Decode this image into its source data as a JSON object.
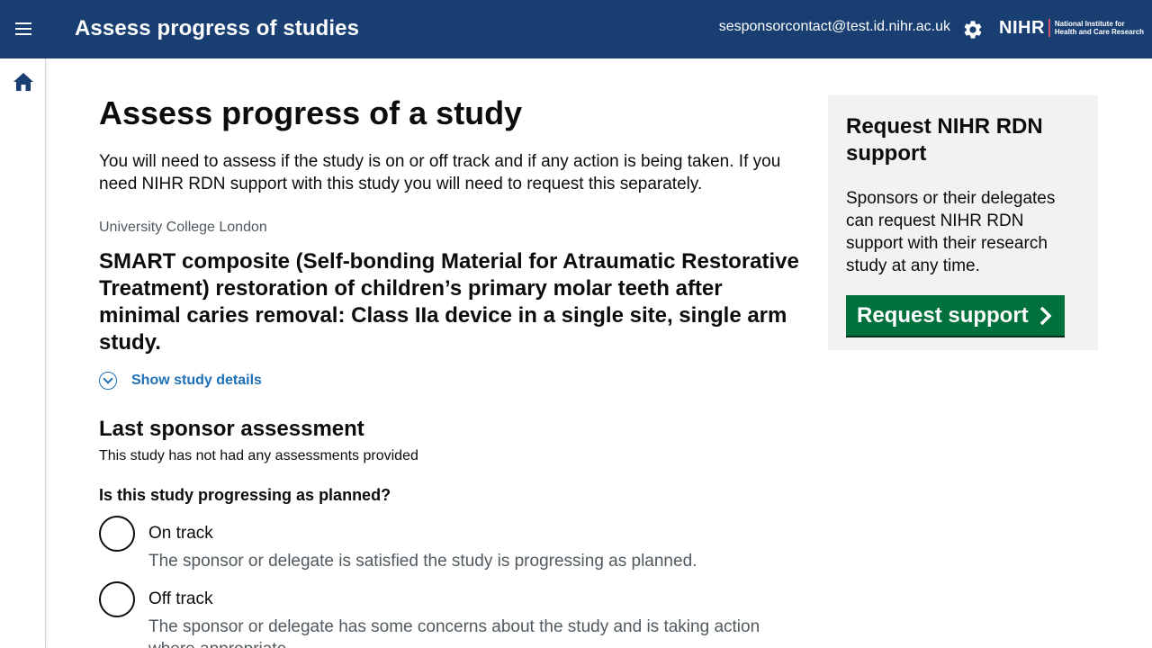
{
  "header": {
    "app_title": "Assess progress of studies",
    "user_email": "sesponsorcontact@test.id.nihr.ac.uk",
    "logo_main": "NIHR",
    "logo_sub_line1": "National Institute for",
    "logo_sub_line2": "Health and Care Research",
    "bg_color": "#193e72"
  },
  "rail": {
    "home_icon": "home-icon"
  },
  "main": {
    "title": "Assess progress of a study",
    "intro": "You will need to assess if the study is on or off track and if any action is being taken. If you need NIHR RDN support with this study you will need to request this separately.",
    "organisation": "University College London",
    "study_title": "SMART composite (Self-bonding Material for Atraumatic Restorative Treatment) restoration of children’s primary molar teeth after minimal caries removal: Class IIa device in a single site, single arm study.",
    "details_link": "Show study details",
    "last_assessment_heading": "Last sponsor assessment",
    "last_assessment_text": "This study has not had any assessments provided",
    "question": "Is this study progressing as planned?",
    "options": [
      {
        "label": "On track",
        "hint": "The sponsor or delegate is satisfied the study is progressing as planned."
      },
      {
        "label": "Off track",
        "hint": "The sponsor or delegate has some concerns about the study and is taking action where appropriate."
      }
    ]
  },
  "panel": {
    "title": "Request NIHR RDN support",
    "text": "Sponsors or their delegates can request NIHR RDN support with their research study at any time.",
    "button_label": "Request support",
    "button_color": "#00703c"
  }
}
